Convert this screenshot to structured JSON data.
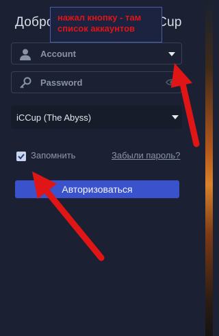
{
  "form": {
    "title": "Добро пожаловать в iCCup",
    "account_placeholder": "Account",
    "password_placeholder": "Password",
    "realm_value": "iCCup (The Abyss)",
    "remember_label": "Запомнить",
    "remember_checked": true,
    "forgot_link": "Забыли пароль?",
    "login_button": "Авторизоваться"
  },
  "annotation": {
    "note_line1": "нажал кнопку - там",
    "note_line2": "список аккаунтов",
    "arrow_color": "#e01515"
  },
  "colors": {
    "accent": "#3a52cc",
    "background": "#1b2132"
  }
}
